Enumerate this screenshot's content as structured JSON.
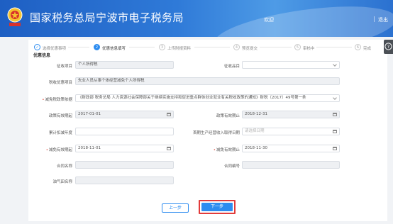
{
  "header": {
    "title": "国家税务总局宁波市电子税务局",
    "user": "欢迎",
    "separator": "|",
    "logout": "退出"
  },
  "steps": [
    {
      "no": "",
      "label": "选择优惠事项",
      "state": "done"
    },
    {
      "no": "2",
      "label": "优惠信息填写",
      "state": "active"
    },
    {
      "no": "3",
      "label": "上传附报资料",
      "state": "todo"
    },
    {
      "no": "4",
      "label": "预览提交",
      "state": "todo"
    },
    {
      "no": "5",
      "label": "审核中",
      "state": "todo"
    },
    {
      "no": "6",
      "label": "完成",
      "state": "todo"
    }
  ],
  "section_title": "优惠信息",
  "form": {
    "tax_type": {
      "label": "征收项目",
      "value": "个人所得税"
    },
    "tax_item": {
      "label": "征收品目",
      "value": ""
    },
    "relief_item": {
      "label": "税收优惠项目",
      "value": "失业人员从事个体经营减免个人所得税"
    },
    "policy_basis": {
      "label": "减免税政策依据",
      "value": "《财政部 税务总局 人力资源社会保障部关于继续实施支持和促进重点群体创业就业有关税收政策的通知》财税〔2017〕49号第一条"
    },
    "policy_start": {
      "label": "政策有效期起",
      "value": "2017-01-01"
    },
    "policy_end": {
      "label": "政策有效期止",
      "value": "2018-12-31"
    },
    "reemploy_year": {
      "label": "累计扣减年度",
      "value": ""
    },
    "prod_date": {
      "label": "首期生产经营收入取得日期",
      "placeholder": "请选择日期"
    },
    "relief_start": {
      "label": "减免有效期起",
      "value": "2018-11-01"
    },
    "relief_end": {
      "label": "减免有效期止",
      "value": "2018-11-30"
    },
    "contract_name": {
      "label": "合同名称",
      "value": ""
    },
    "contract_no": {
      "label": "合同编号",
      "value": ""
    },
    "tax_source_name": {
      "label": "油气田名称",
      "value": ""
    }
  },
  "buttons": {
    "prev": "上一步",
    "next": "下一步"
  },
  "colors": {
    "header": "#2f7ad8",
    "accent": "#2d8cf0",
    "highlight": "#e23b3b"
  }
}
